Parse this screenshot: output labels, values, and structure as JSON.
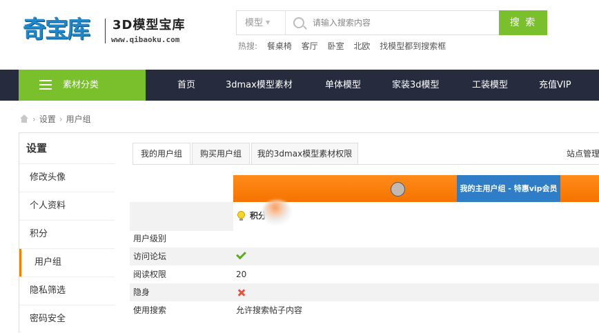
{
  "header": {
    "logo_text": "奇宝库",
    "logo_title": "3D模型宝库",
    "logo_url": "www.qibaoku.com",
    "search": {
      "type_label": "模型",
      "placeholder": "请输入搜索内容",
      "button_label": "搜 索"
    },
    "hot": {
      "label": "热搜:",
      "items": [
        "餐桌椅",
        "客厅",
        "卧室",
        "北欧",
        "找模型都到搜索框"
      ]
    }
  },
  "nav": {
    "category_label": "素材分类",
    "items": [
      "首页",
      "3dmax模型素材",
      "单体模型",
      "家装3d模型",
      "工装模型",
      "充值VIP"
    ]
  },
  "breadcrumb": [
    "设置",
    "用户组"
  ],
  "sidebar": {
    "title": "设置",
    "items": [
      "修改头像",
      "个人资料",
      "积分",
      "用户组",
      "隐私筛选",
      "密码安全"
    ],
    "active_index": 3
  },
  "tabs": [
    "我的用户组",
    "购买用户组",
    "我的3dmax模型素材权限"
  ],
  "site_admin_label": "站点管理",
  "group": {
    "current_label": "我的主用户组 - 特惠vip会员",
    "credits_label": "积分"
  },
  "permissions": [
    {
      "label": "用户级别",
      "value": ""
    },
    {
      "label": "访问论坛",
      "value": "",
      "icon": "check-icon"
    },
    {
      "label": "阅读权限",
      "value": "20"
    },
    {
      "label": "隐身",
      "value": "",
      "icon": "cross-icon"
    },
    {
      "label": "使用搜索",
      "value": "允许搜索帖子内容"
    }
  ],
  "colors": {
    "accent_green": "#7ac02d",
    "nav_bg": "#262c3e",
    "group_orange": "#f57300",
    "group_blue": "#2f7cc7",
    "active_marker": "#f08300"
  }
}
